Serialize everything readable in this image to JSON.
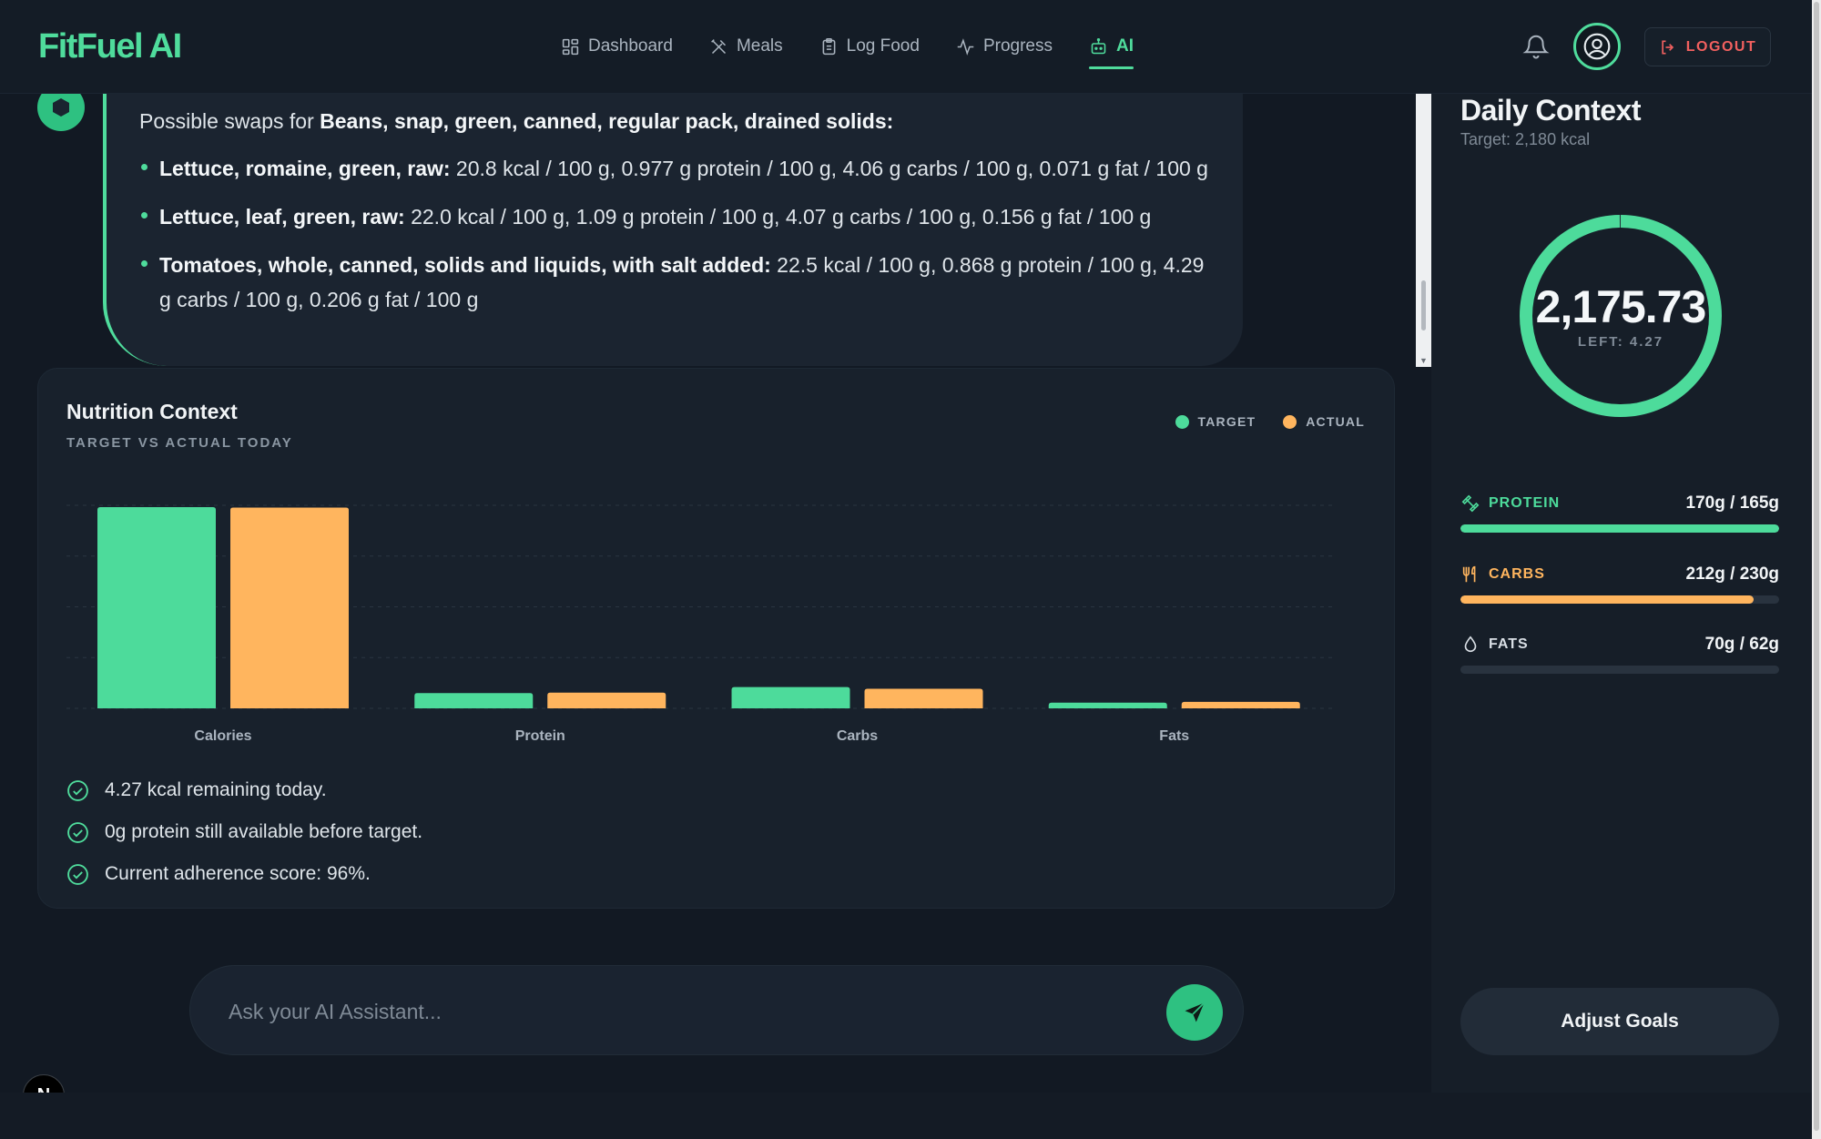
{
  "app": {
    "logo": "FitFuel AI",
    "nav": [
      {
        "label": "Dashboard",
        "icon": "dashboard-icon",
        "active": false
      },
      {
        "label": "Meals",
        "icon": "utensils-icon",
        "active": false
      },
      {
        "label": "Log Food",
        "icon": "clipboard-icon",
        "active": false
      },
      {
        "label": "Progress",
        "icon": "activity-icon",
        "active": false
      },
      {
        "label": "AI",
        "icon": "robot-icon",
        "active": true
      }
    ],
    "logout_label": "LOGOUT"
  },
  "message": {
    "intro_prefix": "Possible swaps for ",
    "intro_food": "Beans, snap, green, canned, regular pack, drained solids:",
    "swaps": [
      {
        "name": "Lettuce, romaine, green, raw:",
        "details": " 20.8 kcal / 100 g, 0.977 g protein / 100 g, 4.06 g carbs / 100 g, 0.071 g fat / 100 g"
      },
      {
        "name": "Lettuce, leaf, green, raw:",
        "details": " 22.0 kcal / 100 g, 1.09 g protein / 100 g, 4.07 g carbs / 100 g, 0.156 g fat / 100 g"
      },
      {
        "name": "Tomatoes, whole, canned, solids and liquids, with salt added:",
        "details": " 22.5 kcal / 100 g, 0.868 g protein / 100 g, 4.29 g carbs / 100 g, 0.206 g fat / 100 g"
      }
    ]
  },
  "nutrition": {
    "title": "Nutrition Context",
    "subtitle": "TARGET VS ACTUAL TODAY",
    "insights": [
      "4.27 kcal remaining today.",
      "0g protein still available before target.",
      "Current adherence score: 96%."
    ]
  },
  "chart_data": {
    "type": "bar",
    "categories": [
      "Calories",
      "Protein",
      "Carbs",
      "Fats"
    ],
    "series": [
      {
        "name": "TARGET",
        "color": "#4ddb9b",
        "values": [
          2180,
          165,
          230,
          62
        ]
      },
      {
        "name": "ACTUAL",
        "color": "#ffb55e",
        "values": [
          2175.73,
          170,
          212,
          70
        ]
      }
    ],
    "ylim": [
      0,
      2200
    ],
    "grid": true,
    "legend": "top-right"
  },
  "input": {
    "placeholder": "Ask your AI Assistant..."
  },
  "badge": "N",
  "sidebar": {
    "title": "Daily Context",
    "subtitle": "Target: 2,180 kcal",
    "ring_value": "2,175.73",
    "ring_left": "LEFT: 4.27",
    "ring_fraction": 0.998,
    "macros": [
      {
        "name": "PROTEIN",
        "value": "170g / 165g",
        "fraction": 1.0,
        "color": "#4ddb9b",
        "label_color": "#4ddb9b",
        "icon": "dumbbell-icon"
      },
      {
        "name": "CARBS",
        "value": "212g / 230g",
        "fraction": 0.92,
        "color": "#ffb55e",
        "label_color": "#ffb55e",
        "icon": "fork-knife-icon"
      },
      {
        "name": "FATS",
        "value": "70g / 62g",
        "fraction": 0,
        "color": "#8a96a2",
        "label_color": "#d9dfe5",
        "icon": "droplet-icon"
      }
    ],
    "adjust_label": "Adjust Goals"
  }
}
